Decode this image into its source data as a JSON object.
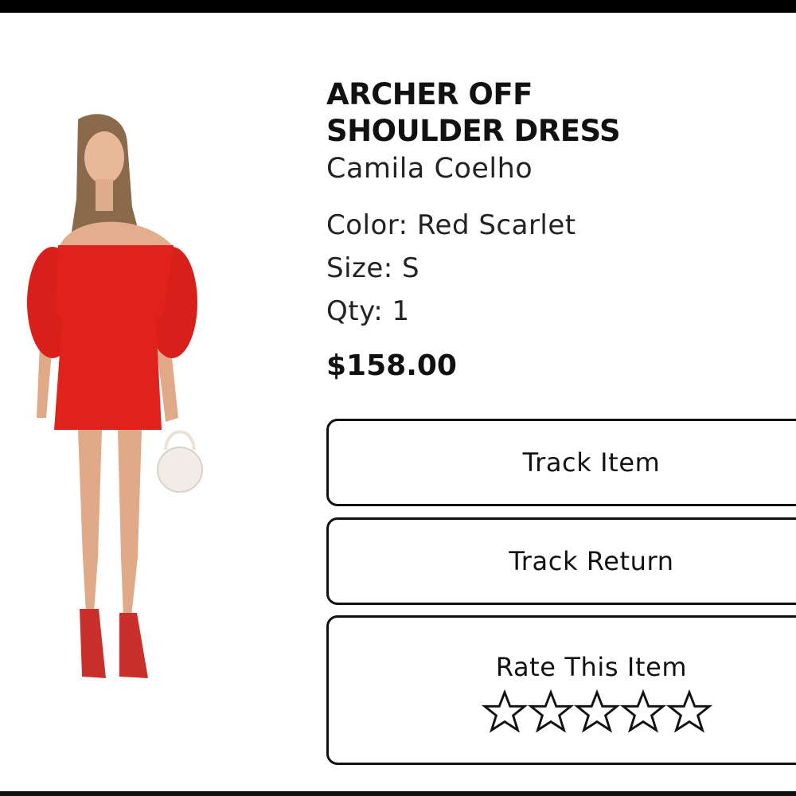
{
  "product": {
    "title_line1": "ARCHER OFF",
    "title_line2": "SHOULDER DRESS",
    "brand": "Camila Coelho",
    "color": "Color: Red Scarlet",
    "size": "Size: S",
    "qty": "Qty: 1",
    "price": "$158.00",
    "dress_color": "#e0211c"
  },
  "actions": {
    "track_item": "Track Item",
    "track_return": "Track Return",
    "rate_label": "Rate This Item",
    "rating": 0,
    "max_rating": 5,
    "star_icon": "star-outline-icon"
  }
}
